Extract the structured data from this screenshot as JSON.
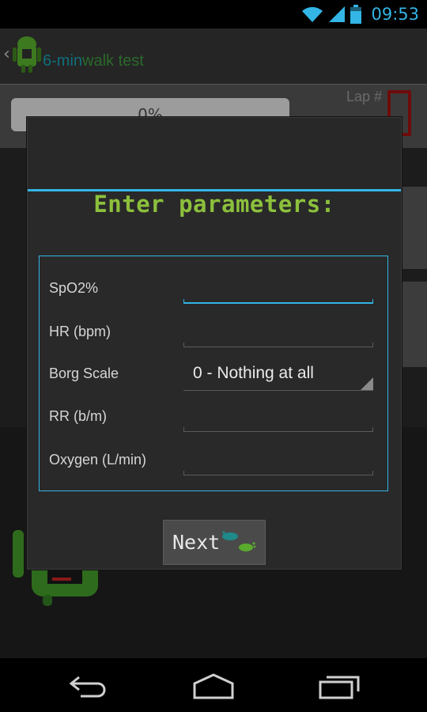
{
  "status_bar": {
    "time": "09:53",
    "icons": [
      "wifi-icon",
      "signal-icon",
      "battery-icon"
    ],
    "accent": "#33b5e5"
  },
  "action_bar": {
    "title_prefix": "6-min",
    "title_suffix": "walk test",
    "icons": [
      "up-caret-icon",
      "android-logo-icon"
    ]
  },
  "background": {
    "progress_text": "0%",
    "lap_label": "Lap #"
  },
  "dialog": {
    "title": "Enter parameters:",
    "title_color": "#8cc03c",
    "fields": [
      {
        "label": "SpO2%",
        "value": "",
        "type": "text",
        "focused": true
      },
      {
        "label": "HR (bpm)",
        "value": "",
        "type": "text"
      },
      {
        "label": "Borg Scale",
        "value": "0 - Nothing at all",
        "type": "select"
      },
      {
        "label": "RR (b/m)",
        "value": "",
        "type": "text"
      },
      {
        "label": "Oxygen (L/min)",
        "value": "",
        "type": "text"
      }
    ],
    "next_button": {
      "label": "Next",
      "icon": "footsteps-icon"
    }
  },
  "nav_bar": {
    "icons": [
      "back-icon",
      "home-icon",
      "recent-apps-icon"
    ]
  }
}
